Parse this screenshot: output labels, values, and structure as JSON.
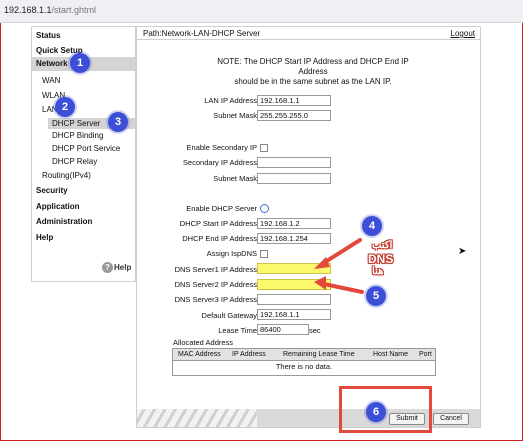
{
  "browser": {
    "url_host": "192.168.1.1",
    "url_path": "/start.ghtml"
  },
  "sidebar": {
    "items": [
      {
        "label": "Status"
      },
      {
        "label": "Quick Setup"
      },
      {
        "label": "Network"
      },
      {
        "label": "WAN"
      },
      {
        "label": "WLAN"
      },
      {
        "label": "LAN"
      },
      {
        "label": "DHCP Server"
      },
      {
        "label": "DHCP Binding"
      },
      {
        "label": "DHCP Port Service"
      },
      {
        "label": "DHCP Relay"
      },
      {
        "label": "Routing(IPv4)"
      },
      {
        "label": "Security"
      },
      {
        "label": "Application"
      },
      {
        "label": "Administration"
      },
      {
        "label": "Help"
      }
    ],
    "help_icon": "?",
    "help_label": "Help"
  },
  "header": {
    "path": "Path:Network-LAN-DHCP Server",
    "logout": "Logout"
  },
  "note": {
    "line1": "NOTE: The DHCP Start IP Address and DHCP End IP Address",
    "line2": "should be in the same subnet as the LAN IP."
  },
  "form": {
    "lan_ip_label": "LAN IP Address",
    "lan_ip_value": "192.168.1.1",
    "subnet_label": "Subnet Mask",
    "subnet_value": "255.255.255.0",
    "enable_secondary_label": "Enable Secondary IP",
    "secondary_ip_label": "Secondary IP Address",
    "secondary_ip_value": "",
    "secondary_mask_label": "Subnet Mask",
    "secondary_mask_value": "",
    "enable_dhcp_label": "Enable DHCP Server",
    "dhcp_start_label": "DHCP Start IP Address",
    "dhcp_start_value": "192.168.1.2",
    "dhcp_end_label": "DHCP End IP Address",
    "dhcp_end_value": "192.168.1.254",
    "assign_ispdns_label": "Assign IspDNS",
    "dns1_label": "DNS Server1 IP Address",
    "dns1_value": "",
    "dns2_label": "DNS Server2 IP Address",
    "dns2_value": "",
    "dns3_label": "DNS Server3 IP Address",
    "dns3_value": "",
    "gateway_label": "Default Gateway",
    "gateway_value": "192.168.1.1",
    "lease_label": "Lease Time",
    "lease_value": "86400",
    "lease_unit": "sec"
  },
  "allocated": {
    "title": "Allocated Address",
    "columns": [
      "MAC Address",
      "IP Address",
      "Remaining Lease Time",
      "Host Name",
      "Port"
    ],
    "empty_text": "There is no data."
  },
  "buttons": {
    "submit": "Submit",
    "cancel": "Cancel"
  },
  "annotations": {
    "badges": [
      "1",
      "2",
      "3",
      "4",
      "5",
      "6"
    ],
    "arabic_line1": "اكتب",
    "arabic_line2": "DNS",
    "arabic_line3": "هنا",
    "accent_color": "#3d4fd6",
    "highlight_color": "#e2493b"
  }
}
